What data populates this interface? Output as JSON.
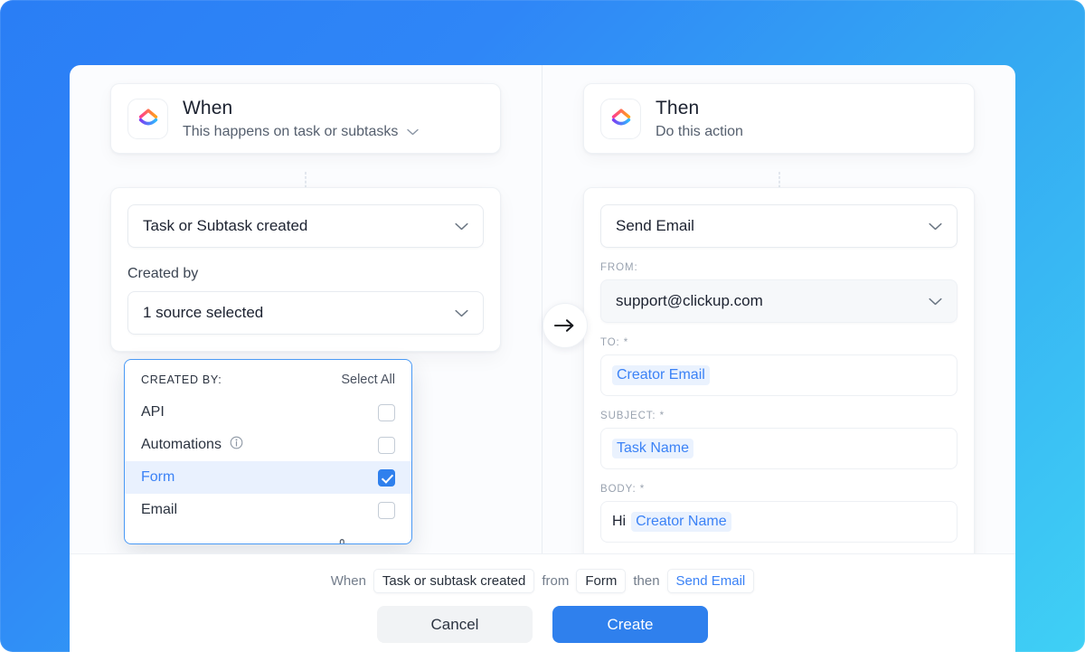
{
  "theme": {
    "bg_gradient_start": "#2a7ef5",
    "bg_gradient_end": "#3fd0f5",
    "accent": "#2f80ed",
    "link": "#3b82f6",
    "card_bg": "#fbfcfe"
  },
  "when_panel": {
    "logo_icon": "clickup-logo-icon",
    "title": "When",
    "subtitle": "This happens on task or subtasks",
    "subtitle_caret": "chevron-down-icon",
    "trigger_value": "Task or Subtask created",
    "trigger_caret": "chevron-down-icon",
    "created_by_label": "Created by",
    "source_value": "1 source selected",
    "source_caret": "chevron-down-icon"
  },
  "then_panel": {
    "logo_icon": "clickup-logo-icon",
    "title": "Then",
    "subtitle": "Do this action",
    "action_value": "Send Email",
    "action_caret": "chevron-down-icon",
    "from_label": "FROM:",
    "from_value": "support@clickup.com",
    "from_caret": "chevron-down-icon",
    "to_label": "TO: *",
    "to_token": "Creator Email",
    "subject_label": "SUBJECT: *",
    "subject_token": "Task Name",
    "body_label": "BODY: *",
    "body_prefix": "Hi",
    "body_token": "Creator Name"
  },
  "connector": {
    "arrow_icon": "arrow-right-icon"
  },
  "dropdown": {
    "header_title": "CREATED BY:",
    "select_all": "Select All",
    "cursor_icon": "pointing-hand-cursor",
    "options": [
      {
        "label": "API",
        "checked": false,
        "info": false
      },
      {
        "label": "Automations",
        "checked": false,
        "info": true
      },
      {
        "label": "Form",
        "checked": true,
        "info": false
      },
      {
        "label": "Email",
        "checked": false,
        "info": false
      }
    ]
  },
  "footer": {
    "summary": {
      "when_word": "When",
      "trigger_chip": "Task or subtask created",
      "from_word": "from",
      "source_chip": "Form",
      "then_word": "then",
      "action_chip": "Send Email"
    },
    "cancel_label": "Cancel",
    "create_label": "Create"
  }
}
